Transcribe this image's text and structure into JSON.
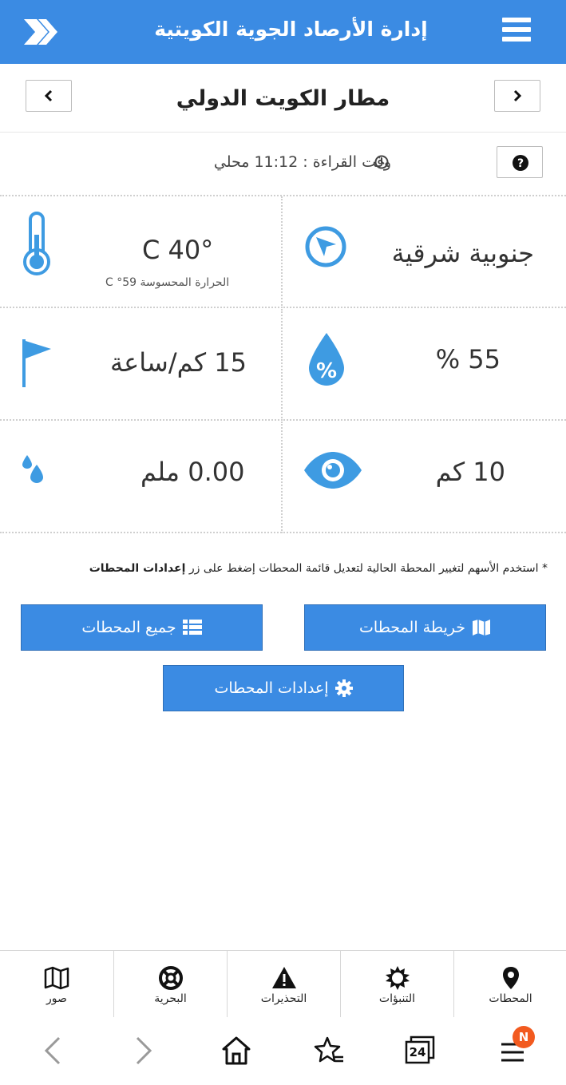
{
  "header": {
    "title": "إدارة الأرصاد الجوية الكويتية"
  },
  "station": {
    "name": "مطار الكويت الدولي"
  },
  "reading": {
    "time_text": "وقت القراءة : 11:12 محلي"
  },
  "weather": {
    "temperature": "40° C",
    "feels_like": "الحرارة المحسوسة  59° C",
    "wind_direction": "جنوبية شرقية",
    "wind_speed": "15 كم/ساعة",
    "humidity": "55 %",
    "rainfall": "0.00 ملم",
    "visibility": "10 كم"
  },
  "note": {
    "text": "* استخدم الأسهم لتغيير المحطة الحالية لتعديل قائمة المحطات إضغط على زر ",
    "bold": "إعدادات المحطات"
  },
  "buttons": {
    "map": "خريطة المحطات",
    "all": "جميع المحطات",
    "settings": "إعدادات المحطات"
  },
  "tabs": [
    {
      "label": "صور",
      "icon": "map-icon"
    },
    {
      "label": "البحرية",
      "icon": "lifebuoy-icon"
    },
    {
      "label": "التحذيرات",
      "icon": "warning-icon"
    },
    {
      "label": "التنبؤات",
      "icon": "sun-icon"
    },
    {
      "label": "المحطات",
      "icon": "location-pin-icon"
    }
  ],
  "browser": {
    "tab_count": "24",
    "badge": "N"
  },
  "colors": {
    "primary": "#3b8be3",
    "icon_blue": "#3e9be2",
    "badge": "#f25a1f"
  }
}
